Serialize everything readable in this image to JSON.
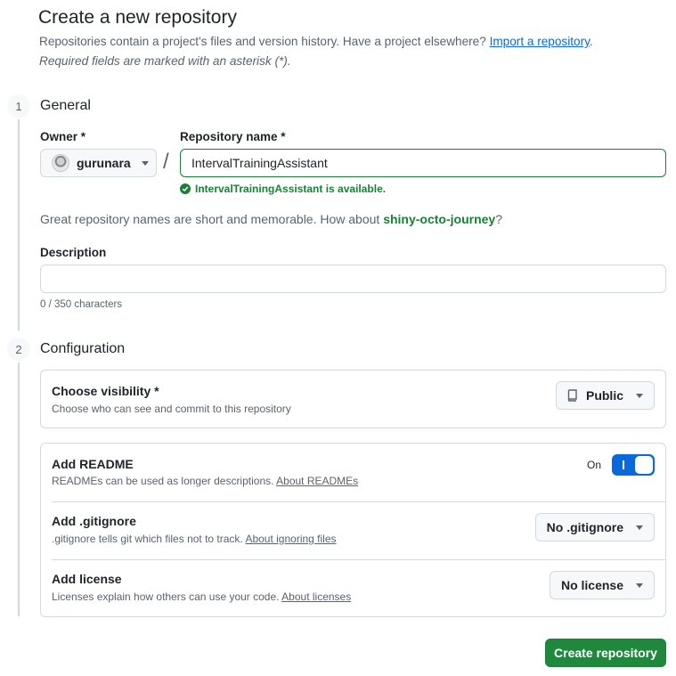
{
  "header": {
    "title": "Create a new repository",
    "intro": "Repositories contain a project's files and version history. Have a project elsewhere?",
    "import_link": "Import a repository",
    "intro_end": ".",
    "required_note": "Required fields are marked with an asterisk (*)."
  },
  "steps": {
    "general": {
      "number": "1",
      "title": "General"
    },
    "configuration": {
      "number": "2",
      "title": "Configuration"
    }
  },
  "owner": {
    "label": "Owner *",
    "value": "gurunara"
  },
  "slash": "/",
  "repository_name": {
    "label": "Repository name *",
    "value": "IntervalTrainingAssistant",
    "availability": "IntervalTrainingAssistant is available."
  },
  "suggestion": {
    "prefix": "Great repository names are short and memorable. How about",
    "name": "shiny-octo-journey",
    "suffix": "?"
  },
  "description": {
    "label": "Description",
    "value": "",
    "char_count": "0 / 350 characters"
  },
  "visibility": {
    "title": "Choose visibility *",
    "subtitle": "Choose who can see and commit to this repository",
    "selected": "Public"
  },
  "readme": {
    "title": "Add README",
    "subtitle": "READMEs can be used as longer descriptions.",
    "link": "About READMEs",
    "toggle_label": "On",
    "enabled": true
  },
  "gitignore": {
    "title": "Add .gitignore",
    "subtitle": ".gitignore tells git which files not to track.",
    "link": "About ignoring files",
    "selected": "No .gitignore"
  },
  "license": {
    "title": "Add license",
    "subtitle": "Licenses explain how others can use your code.",
    "link": "About licenses",
    "selected": "No license"
  },
  "submit": {
    "label": "Create repository"
  },
  "colors": {
    "primary_button": "#1f883d",
    "success_text": "#1a7f37",
    "link": "#0969da",
    "toggle_on": "#0969da"
  }
}
